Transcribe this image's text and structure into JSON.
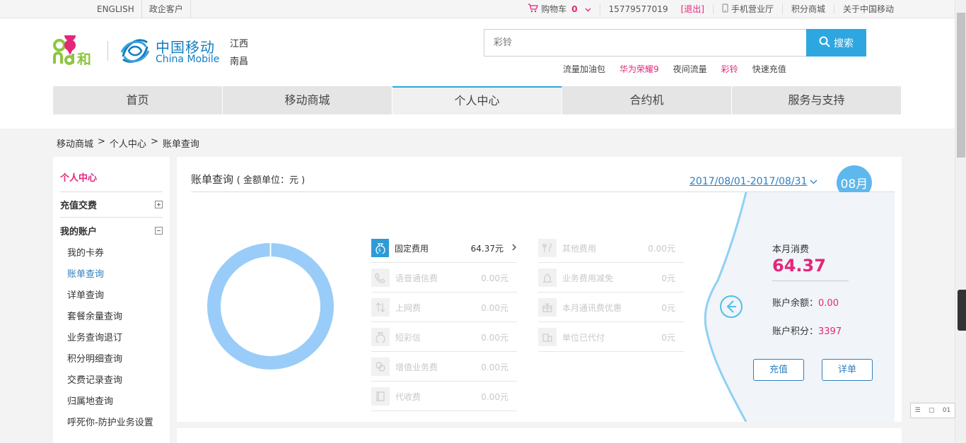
{
  "topbar": {
    "english": "ENGLISH",
    "gov": "政企客户",
    "cart": "购物车",
    "cart_count": "0",
    "phone": "15779577019",
    "logout": "[退出]",
    "mobile_hall": "手机营业厅",
    "points_mall": "积分商城",
    "about": "关于中国移动"
  },
  "header": {
    "brand_cn": "中国移动",
    "brand_en": "China Mobile",
    "province": "江西",
    "city": "南昌",
    "search_placeholder": "彩铃",
    "search_button": "搜索",
    "hot_words": [
      "流量加油包",
      "华为荣耀9",
      "夜间流量",
      "彩铃",
      "快速充值"
    ]
  },
  "nav": {
    "tabs": [
      "首页",
      "移动商城",
      "个人中心",
      "合约机",
      "服务与支持"
    ]
  },
  "breadcrumb": {
    "items": [
      "移动商城",
      "个人中心",
      "账单查询"
    ],
    "sep": ">"
  },
  "sidebar": {
    "title": "个人中心",
    "group_recharge": "充值交费",
    "group_account": "我的账户",
    "items": [
      "我的卡券",
      "账单查询",
      "详单查询",
      "套餐余量查询",
      "业务查询退订",
      "积分明细查询",
      "交费记录查询",
      "归属地查询",
      "呼死你-防护业务设置"
    ]
  },
  "bill": {
    "title": "账单查询",
    "unit_note": "( 金额单位：元 )",
    "date_range": "2017/08/01-2017/08/31",
    "month": "08月",
    "fees_left": [
      {
        "name": "固定费用",
        "amount": "64.37元"
      },
      {
        "name": "语音通信费",
        "amount": "0.00元"
      },
      {
        "name": "上网费",
        "amount": "0.00元"
      },
      {
        "name": "短彩信",
        "amount": "0.00元"
      },
      {
        "name": "增值业务费",
        "amount": "0.00元"
      },
      {
        "name": "代收费",
        "amount": "0.00元"
      }
    ],
    "fees_right": [
      {
        "name": "其他费用",
        "amount": "0.00元"
      },
      {
        "name": "业务费用减免",
        "amount": "0元"
      },
      {
        "name": "本月通讯费优惠",
        "amount": "0元"
      },
      {
        "name": "单位已代付",
        "amount": "0元"
      }
    ],
    "summary": {
      "month_spend_label": "本月消费",
      "month_spend": "64.37",
      "balance_label": "账户余额：",
      "balance": "0.00",
      "points_label": "账户积分：",
      "points": "3397",
      "recharge_button": "充值",
      "detail_button": "详单"
    },
    "donut_share_fixed_fee": 1.0
  },
  "colors": {
    "accent_blue": "#2ea7e0",
    "link_blue": "#2e7fc1",
    "brand_pink": "#e4267a",
    "donut_blue": "#99ccf8"
  },
  "float_tools": {
    "count": "01"
  }
}
